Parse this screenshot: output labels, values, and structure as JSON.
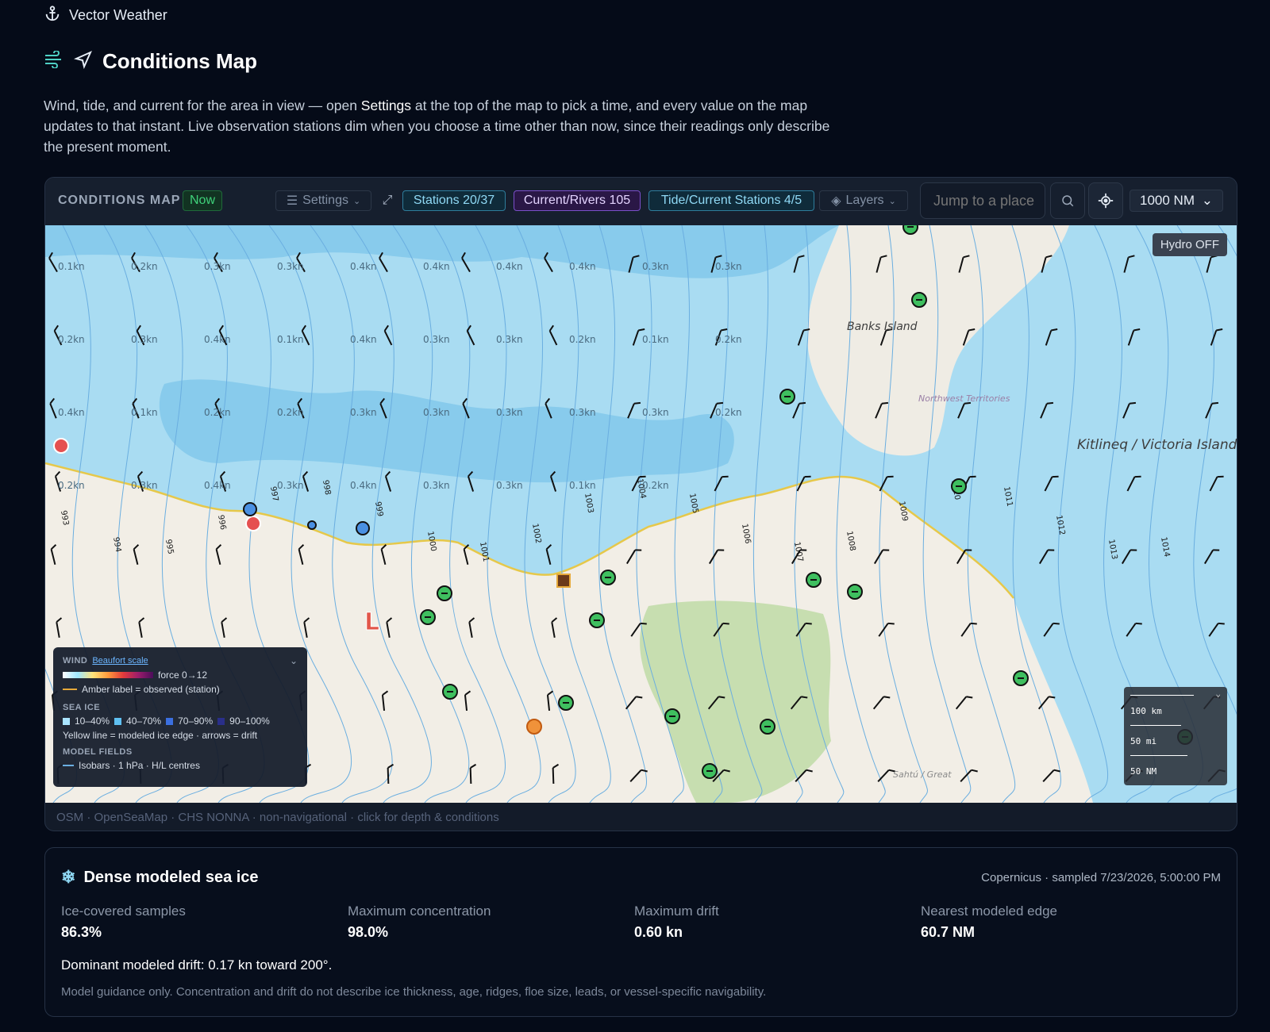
{
  "app": {
    "title": "Vector Weather",
    "icon": "anchor-icon"
  },
  "page": {
    "title": "Conditions Map",
    "intro_before": "Wind, tide, and current for the area in view — open ",
    "intro_bold": "Settings",
    "intro_after": " at the top of the map to pick a time, and every value on the map updates to that instant. Live observation stations dim when you choose a time other than now, since their readings only describe the present moment."
  },
  "toolbar": {
    "label": "CONDITIONS MAP",
    "now": "Now",
    "settings": "Settings",
    "stations": "Stations 20/37",
    "current": "Current/Rivers 105",
    "tide": "Tide/Current Stations 4/5",
    "layers": "Layers",
    "search_placeholder": "Jump to a place",
    "range": "1000 NM"
  },
  "map": {
    "hydro": "Hydro OFF",
    "place_labels": [
      "Banks Island",
      "Northwest Territories",
      "Kitlineq / Victoria Island",
      "Sahtú / Great"
    ],
    "current_labels": [
      "0.1kn",
      "0.2kn",
      "0.3kn",
      "0.3kn",
      "0.4kn",
      "0.4kn",
      "0.4kn",
      "0.4kn",
      "0.3kn",
      "0.3kn",
      "0.2kn",
      "0.3kn",
      "0.4kn",
      "0.1kn",
      "0.4kn",
      "0.3kn",
      "0.3kn",
      "0.2kn",
      "0.1kn",
      "0.2kn",
      "0.4kn",
      "0.1kn",
      "0.2kn",
      "0.2kn",
      "0.3kn",
      "0.3kn",
      "0.3kn",
      "0.3kn",
      "0.3kn",
      "0.2kn",
      "0.2kn",
      "0.3kn",
      "0.4kn",
      "0.3kn",
      "0.4kn",
      "0.3kn",
      "0.3kn",
      "0.1kn",
      "0.2kn"
    ],
    "isobars": [
      "993",
      "994",
      "995",
      "996",
      "997",
      "998",
      "999",
      "1000",
      "1001",
      "1002",
      "1003",
      "1004",
      "1005",
      "1006",
      "1007",
      "1008",
      "1009",
      "1010",
      "1011",
      "1012",
      "1013",
      "1014"
    ],
    "pressure_centre": "L",
    "legend": {
      "wind_label": "WIND",
      "wind_link": "Beaufort scale",
      "wind_force": "force 0→12",
      "amber": "Amber label = observed (station)",
      "seaice_label": "SEA ICE",
      "ice_bins": [
        "10–40%",
        "40–70%",
        "70–90%",
        "90–100%"
      ],
      "ice_note": "Yellow line = modeled ice edge · arrows = drift",
      "model_label": "MODEL FIELDS",
      "model_note": "Isobars · 1 hPa · H/L centres"
    },
    "scale": {
      "km": "100 km",
      "mi": "50 mi",
      "nm": "50 NM"
    },
    "attribution": "OSM · OpenSeaMap · CHS NONNA · non-navigational · click for depth & conditions"
  },
  "ice": {
    "title": "Dense modeled sea ice",
    "source": "Copernicus · sampled 7/23/2026, 5:00:00 PM",
    "stats": [
      {
        "label": "Ice-covered samples",
        "value": "86.3%"
      },
      {
        "label": "Maximum concentration",
        "value": "98.0%"
      },
      {
        "label": "Maximum drift",
        "value": "0.60 kn"
      },
      {
        "label": "Nearest modeled edge",
        "value": "60.7 NM"
      }
    ],
    "drift": "Dominant modeled drift: 0.17 kn toward 200°.",
    "note": "Model guidance only. Concentration and drift do not describe ice thickness, age, ridges, floe size, leads, or vessel-specific navigability."
  },
  "colors": {
    "background": "#050b18",
    "card": "#131b29",
    "ice": "#a9dcf2",
    "land": "#f2eee6",
    "ice_edge": "#e6c84a",
    "isobar": "#6aaee0"
  }
}
